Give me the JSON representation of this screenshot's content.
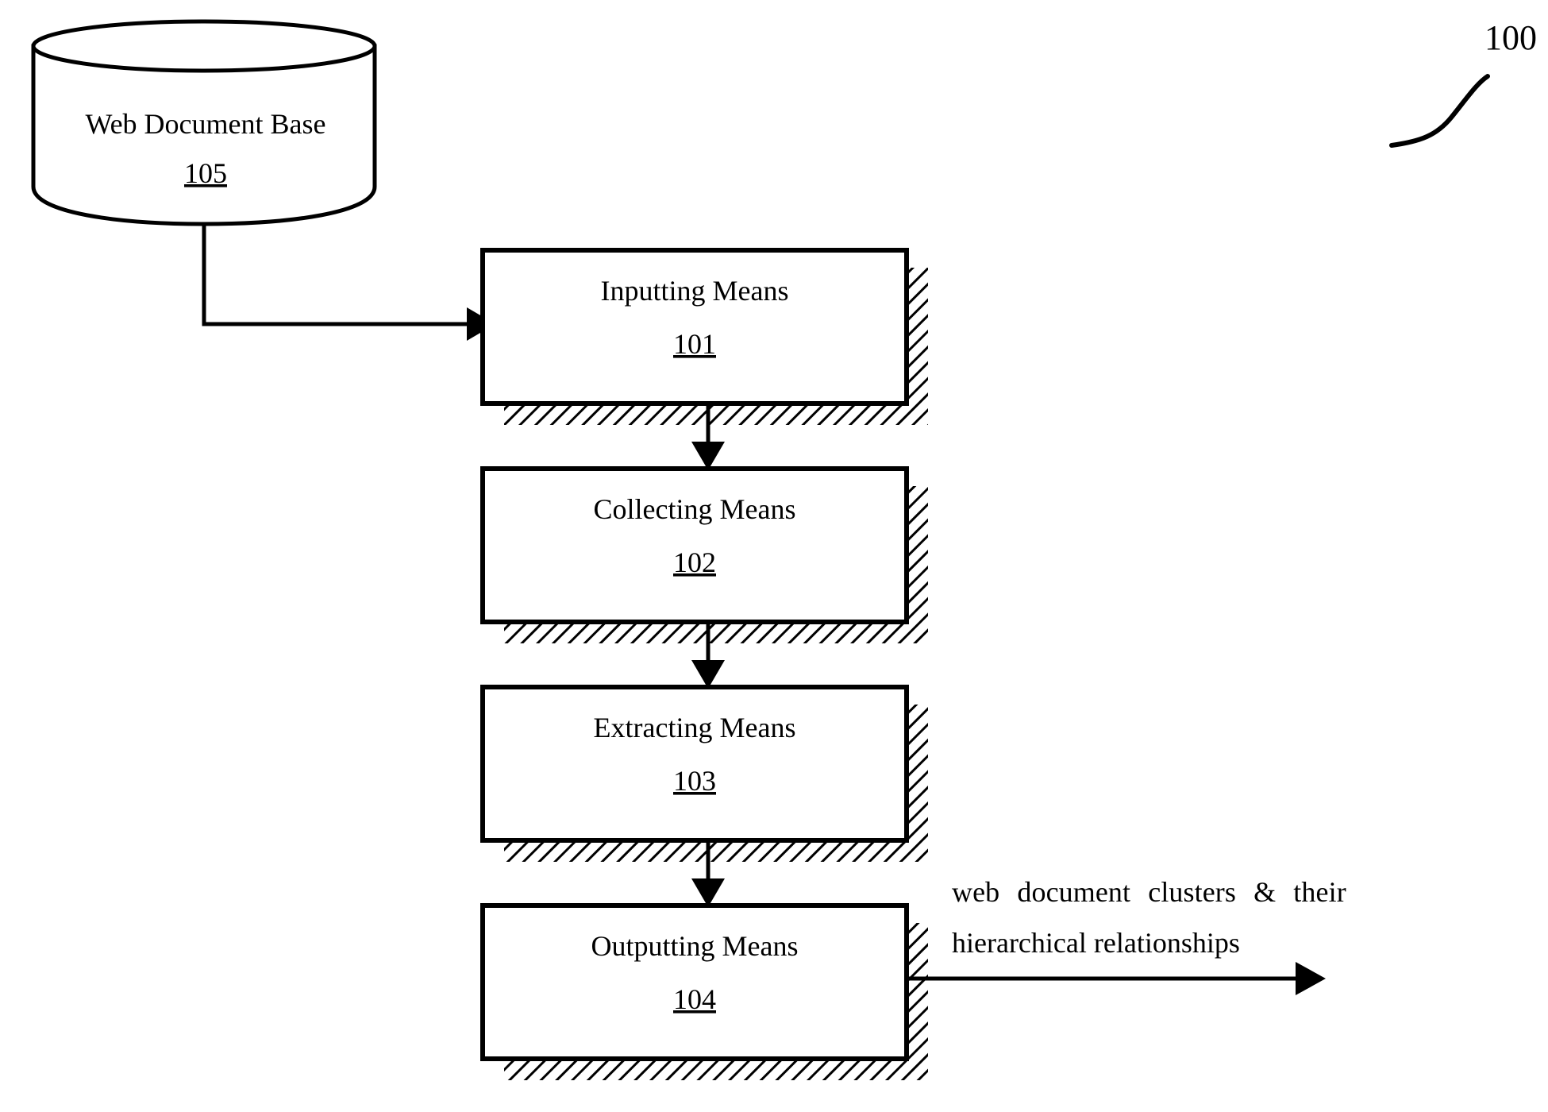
{
  "figure": {
    "reference_numeral": "100",
    "background_color": "#ffffff",
    "line_color": "#000000"
  },
  "datastore": {
    "label": "Web Document Base",
    "reference": "105",
    "shape": "cylinder"
  },
  "process_boxes": [
    {
      "label": "Inputting Means",
      "reference": "101",
      "shape": "rectangle-with-hatched-shadow"
    },
    {
      "label": "Collecting Means",
      "reference": "102",
      "shape": "rectangle-with-hatched-shadow"
    },
    {
      "label": "Extracting Means",
      "reference": "103",
      "shape": "rectangle-with-hatched-shadow"
    },
    {
      "label": "Outputting Means",
      "reference": "104",
      "shape": "rectangle-with-hatched-shadow"
    }
  ],
  "output_flow": {
    "line1": "web  document  clusters  &  their",
    "line2": "hierarchical relationships"
  }
}
